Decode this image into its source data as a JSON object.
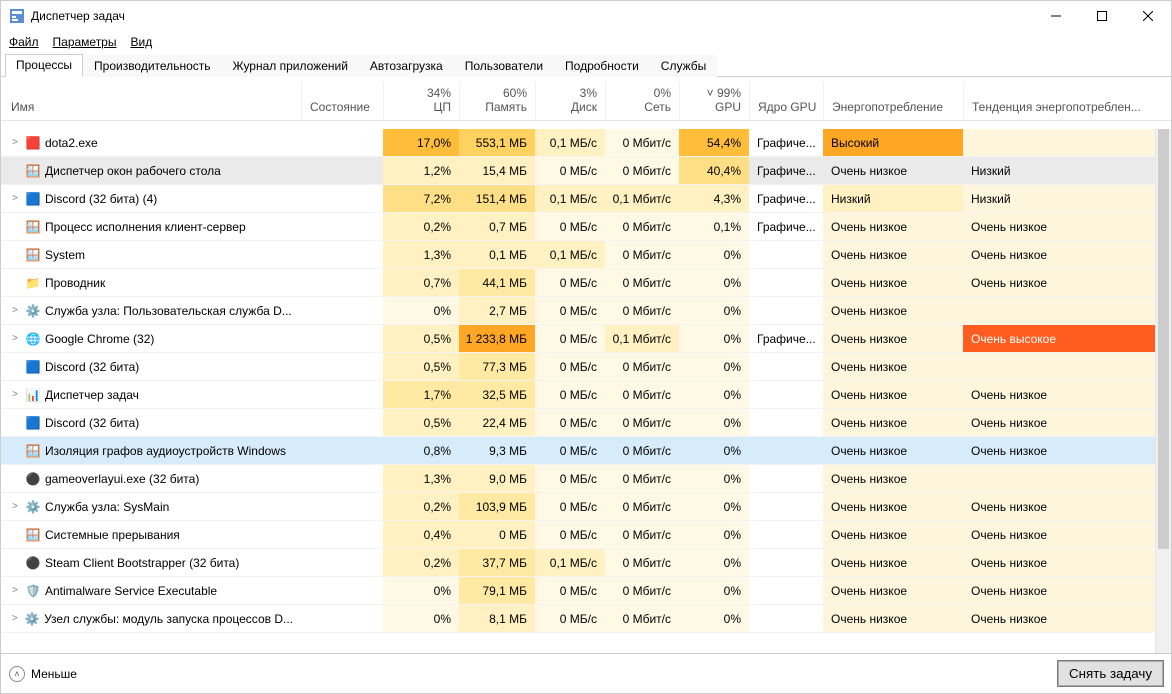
{
  "window": {
    "title": "Диспетчер задач"
  },
  "menu": {
    "file": "Файл",
    "options": "Параметры",
    "view": "Вид"
  },
  "tabs": {
    "t0": "Процессы",
    "t1": "Производительность",
    "t2": "Журнал приложений",
    "t3": "Автозагрузка",
    "t4": "Пользователи",
    "t5": "Подробности",
    "t6": "Службы"
  },
  "columns": {
    "name": "Имя",
    "state": "Состояние",
    "cpu_top": "34%",
    "cpu": "ЦП",
    "mem_top": "60%",
    "mem": "Память",
    "disk_top": "3%",
    "disk": "Диск",
    "net_top": "0%",
    "net": "Сеть",
    "gpu_top": "99%",
    "gpu": "GPU",
    "gpue": "Ядро GPU",
    "pow": "Энергопотребление",
    "trend": "Тенденция энергопотреблен..."
  },
  "rows": [
    {
      "exp": ">",
      "icon": "🟥",
      "name": "dota2.exe",
      "cpu": "17,0%",
      "cpu_h": "h5",
      "mem": "553,1 МБ",
      "mem_h": "h4",
      "disk": "0,1 МБ/с",
      "disk_h": "h1",
      "net": "0 Мбит/с",
      "net_h": "h0",
      "gpu": "54,4%",
      "gpu_h": "h5",
      "gpue": "Графиче...",
      "pow": "Высокий",
      "pow_h": "h6",
      "trend": "",
      "trend_h": "hb"
    },
    {
      "exp": "",
      "icon": "🪟",
      "name": "Диспетчер окон рабочего стола",
      "rowcls": "gray",
      "cpu": "1,2%",
      "cpu_h": "h1",
      "mem": "15,4 МБ",
      "mem_h": "h1",
      "disk": "0 МБ/с",
      "disk_h": "h0",
      "net": "0 Мбит/с",
      "net_h": "h0",
      "gpu": "40,4%",
      "gpu_h": "h3",
      "gpue": "Графиче...",
      "pow": "Очень низкое",
      "pow_h": "",
      "trend": "Низкий",
      "trend_h": ""
    },
    {
      "exp": ">",
      "icon": "🟦",
      "name": "Discord (32 бита) (4)",
      "cpu": "7,2%",
      "cpu_h": "h3",
      "mem": "151,4 МБ",
      "mem_h": "h3",
      "disk": "0,1 МБ/с",
      "disk_h": "h1",
      "net": "0,1 Мбит/с",
      "net_h": "h1",
      "gpu": "4,3%",
      "gpu_h": "h1",
      "gpue": "Графиче...",
      "pow": "Низкий",
      "pow_h": "h1",
      "trend": "Низкий",
      "trend_h": "hb"
    },
    {
      "exp": "",
      "icon": "🪟",
      "name": "Процесс исполнения клиент-сервер",
      "cpu": "0,2%",
      "cpu_h": "h1",
      "mem": "0,7 МБ",
      "mem_h": "h1",
      "disk": "0 МБ/с",
      "disk_h": "h0",
      "net": "0 Мбит/с",
      "net_h": "h0",
      "gpu": "0,1%",
      "gpu_h": "h0",
      "gpue": "Графиче...",
      "pow": "Очень низкое",
      "pow_h": "hb",
      "trend": "Очень низкое",
      "trend_h": "hb"
    },
    {
      "exp": "",
      "icon": "🪟",
      "name": "System",
      "cpu": "1,3%",
      "cpu_h": "h1",
      "mem": "0,1 МБ",
      "mem_h": "h1",
      "disk": "0,1 МБ/с",
      "disk_h": "h1",
      "net": "0 Мбит/с",
      "net_h": "h0",
      "gpu": "0%",
      "gpu_h": "h0",
      "gpue": "",
      "pow": "Очень низкое",
      "pow_h": "hb",
      "trend": "Очень низкое",
      "trend_h": "hb"
    },
    {
      "exp": "",
      "icon": "📁",
      "name": "Проводник",
      "cpu": "0,7%",
      "cpu_h": "h1",
      "mem": "44,1 МБ",
      "mem_h": "h2",
      "disk": "0 МБ/с",
      "disk_h": "h0",
      "net": "0 Мбит/с",
      "net_h": "h0",
      "gpu": "0%",
      "gpu_h": "h0",
      "gpue": "",
      "pow": "Очень низкое",
      "pow_h": "hb",
      "trend": "Очень низкое",
      "trend_h": "hb"
    },
    {
      "exp": ">",
      "icon": "⚙️",
      "name": "Служба узла: Пользовательская служба D...",
      "cpu": "0%",
      "cpu_h": "h0",
      "mem": "2,7 МБ",
      "mem_h": "h1",
      "disk": "0 МБ/с",
      "disk_h": "h0",
      "net": "0 Мбит/с",
      "net_h": "h0",
      "gpu": "0%",
      "gpu_h": "h0",
      "gpue": "",
      "pow": "Очень низкое",
      "pow_h": "hb",
      "trend": "",
      "trend_h": "hb"
    },
    {
      "exp": ">",
      "icon": "🌐",
      "name": "Google Chrome (32)",
      "cpu": "0,5%",
      "cpu_h": "h1",
      "mem": "1 233,8 МБ",
      "mem_h": "h6",
      "disk": "0 МБ/с",
      "disk_h": "h0",
      "net": "0,1 Мбит/с",
      "net_h": "h1",
      "gpu": "0%",
      "gpu_h": "h0",
      "gpue": "Графиче...",
      "pow": "Очень низкое",
      "pow_h": "hb",
      "trend": "Очень высокое",
      "trend_h": "h8"
    },
    {
      "exp": "",
      "icon": "🟦",
      "name": "Discord (32 бита)",
      "cpu": "0,5%",
      "cpu_h": "h1",
      "mem": "77,3 МБ",
      "mem_h": "h2",
      "disk": "0 МБ/с",
      "disk_h": "h0",
      "net": "0 Мбит/с",
      "net_h": "h0",
      "gpu": "0%",
      "gpu_h": "h0",
      "gpue": "",
      "pow": "Очень низкое",
      "pow_h": "hb",
      "trend": "",
      "trend_h": "hb"
    },
    {
      "exp": ">",
      "icon": "📊",
      "name": "Диспетчер задач",
      "cpu": "1,7%",
      "cpu_h": "h2",
      "mem": "32,5 МБ",
      "mem_h": "h2",
      "disk": "0 МБ/с",
      "disk_h": "h0",
      "net": "0 Мбит/с",
      "net_h": "h0",
      "gpu": "0%",
      "gpu_h": "h0",
      "gpue": "",
      "pow": "Очень низкое",
      "pow_h": "hb",
      "trend": "Очень низкое",
      "trend_h": "hb"
    },
    {
      "exp": "",
      "icon": "🟦",
      "name": "Discord (32 бита)",
      "cpu": "0,5%",
      "cpu_h": "h1",
      "mem": "22,4 МБ",
      "mem_h": "h1",
      "disk": "0 МБ/с",
      "disk_h": "h0",
      "net": "0 Мбит/с",
      "net_h": "h0",
      "gpu": "0%",
      "gpu_h": "h0",
      "gpue": "",
      "pow": "Очень низкое",
      "pow_h": "hb",
      "trend": "Очень низкое",
      "trend_h": "hb"
    },
    {
      "exp": "",
      "icon": "🪟",
      "name": "Изоляция графов аудиоустройств Windows",
      "rowcls": "sel",
      "cpu": "0,8%",
      "cpu_h": "sel",
      "mem": "9,3 МБ",
      "mem_h": "sel",
      "disk": "0 МБ/с",
      "disk_h": "sel",
      "net": "0 Мбит/с",
      "net_h": "sel",
      "gpu": "0%",
      "gpu_h": "sel",
      "gpue": "",
      "pow": "Очень низкое",
      "pow_h": "sel",
      "trend": "Очень низкое",
      "trend_h": "sel"
    },
    {
      "exp": "",
      "icon": "⚫",
      "name": "gameoverlayui.exe (32 бита)",
      "cpu": "1,3%",
      "cpu_h": "h1",
      "mem": "9,0 МБ",
      "mem_h": "h1",
      "disk": "0 МБ/с",
      "disk_h": "h0",
      "net": "0 Мбит/с",
      "net_h": "h0",
      "gpu": "0%",
      "gpu_h": "h0",
      "gpue": "",
      "pow": "Очень низкое",
      "pow_h": "hb",
      "trend": "",
      "trend_h": "hb"
    },
    {
      "exp": ">",
      "icon": "⚙️",
      "name": "Служба узла: SysMain",
      "cpu": "0,2%",
      "cpu_h": "h1",
      "mem": "103,9 МБ",
      "mem_h": "h2",
      "disk": "0 МБ/с",
      "disk_h": "h0",
      "net": "0 Мбит/с",
      "net_h": "h0",
      "gpu": "0%",
      "gpu_h": "h0",
      "gpue": "",
      "pow": "Очень низкое",
      "pow_h": "hb",
      "trend": "Очень низкое",
      "trend_h": "hb"
    },
    {
      "exp": "",
      "icon": "🪟",
      "name": "Системные прерывания",
      "cpu": "0,4%",
      "cpu_h": "h1",
      "mem": "0 МБ",
      "mem_h": "h1",
      "disk": "0 МБ/с",
      "disk_h": "h0",
      "net": "0 Мбит/с",
      "net_h": "h0",
      "gpu": "0%",
      "gpu_h": "h0",
      "gpue": "",
      "pow": "Очень низкое",
      "pow_h": "hb",
      "trend": "Очень низкое",
      "trend_h": "hb"
    },
    {
      "exp": "",
      "icon": "⚫",
      "name": "Steam Client Bootstrapper (32 бита)",
      "cpu": "0,2%",
      "cpu_h": "h1",
      "mem": "37,7 МБ",
      "mem_h": "h2",
      "disk": "0,1 МБ/с",
      "disk_h": "h1",
      "net": "0 Мбит/с",
      "net_h": "h0",
      "gpu": "0%",
      "gpu_h": "h0",
      "gpue": "",
      "pow": "Очень низкое",
      "pow_h": "hb",
      "trend": "Очень низкое",
      "trend_h": "hb"
    },
    {
      "exp": ">",
      "icon": "🛡️",
      "name": "Antimalware Service Executable",
      "cpu": "0%",
      "cpu_h": "h0",
      "mem": "79,1 МБ",
      "mem_h": "h2",
      "disk": "0 МБ/с",
      "disk_h": "h0",
      "net": "0 Мбит/с",
      "net_h": "h0",
      "gpu": "0%",
      "gpu_h": "h0",
      "gpue": "",
      "pow": "Очень низкое",
      "pow_h": "hb",
      "trend": "Очень низкое",
      "trend_h": "hb"
    },
    {
      "exp": ">",
      "icon": "⚙️",
      "name": "Узел службы: модуль запуска процессов D...",
      "cpu": "0%",
      "cpu_h": "h0",
      "mem": "8,1 МБ",
      "mem_h": "h1",
      "disk": "0 МБ/с",
      "disk_h": "h0",
      "net": "0 Мбит/с",
      "net_h": "h0",
      "gpu": "0%",
      "gpu_h": "h0",
      "gpue": "",
      "pow": "Очень низкое",
      "pow_h": "hb",
      "trend": "Очень низкое",
      "trend_h": "hb"
    }
  ],
  "footer": {
    "less": "Меньше",
    "endtask": "Снять задачу"
  }
}
